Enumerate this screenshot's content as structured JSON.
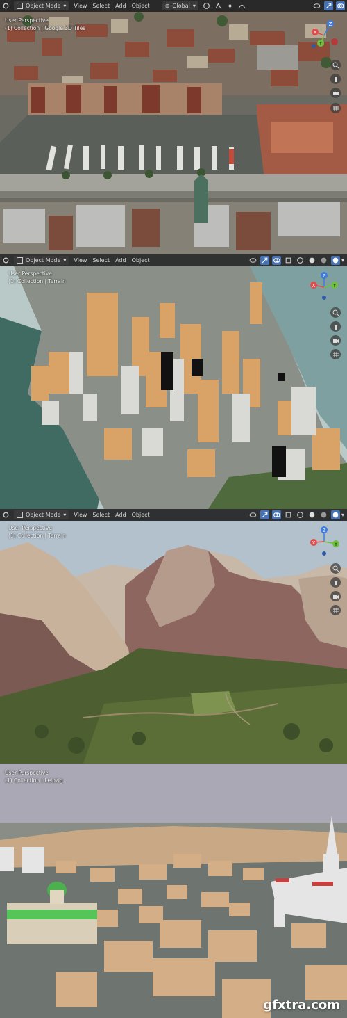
{
  "panels": [
    {
      "toolbar": {
        "mode": "Object Mode",
        "view": "View",
        "select": "Select",
        "add": "Add",
        "object": "Object",
        "orientation": "Global"
      },
      "viewport": {
        "perspective": "User Perspective",
        "collection": "(1) Collection | Google 3D Tiles"
      }
    },
    {
      "toolbar": {
        "mode": "Object Mode",
        "view": "View",
        "select": "Select",
        "add": "Add",
        "object": "Object"
      },
      "viewport": {
        "perspective": "User Perspective",
        "collection": "(1) Collection | Terrain"
      }
    },
    {
      "toolbar": {
        "mode": "Object Mode",
        "view": "View",
        "select": "Select",
        "add": "Add",
        "object": "Object"
      },
      "viewport": {
        "perspective": "User Perspective",
        "collection": "(1) Collection | Terrain"
      }
    },
    {
      "viewport": {
        "perspective": "User Perspective",
        "collection": "(1) Collection | Leipzig"
      }
    }
  ],
  "gizmo": {
    "x": "X",
    "y": "Y",
    "z": "Z"
  },
  "watermark": "gfxtra.com",
  "colors": {
    "toolbar_bg": "#242424",
    "accent": "#4772b3",
    "axis_x": "#e34a4a",
    "axis_y": "#6ec13b",
    "axis_z": "#3d7be0"
  }
}
